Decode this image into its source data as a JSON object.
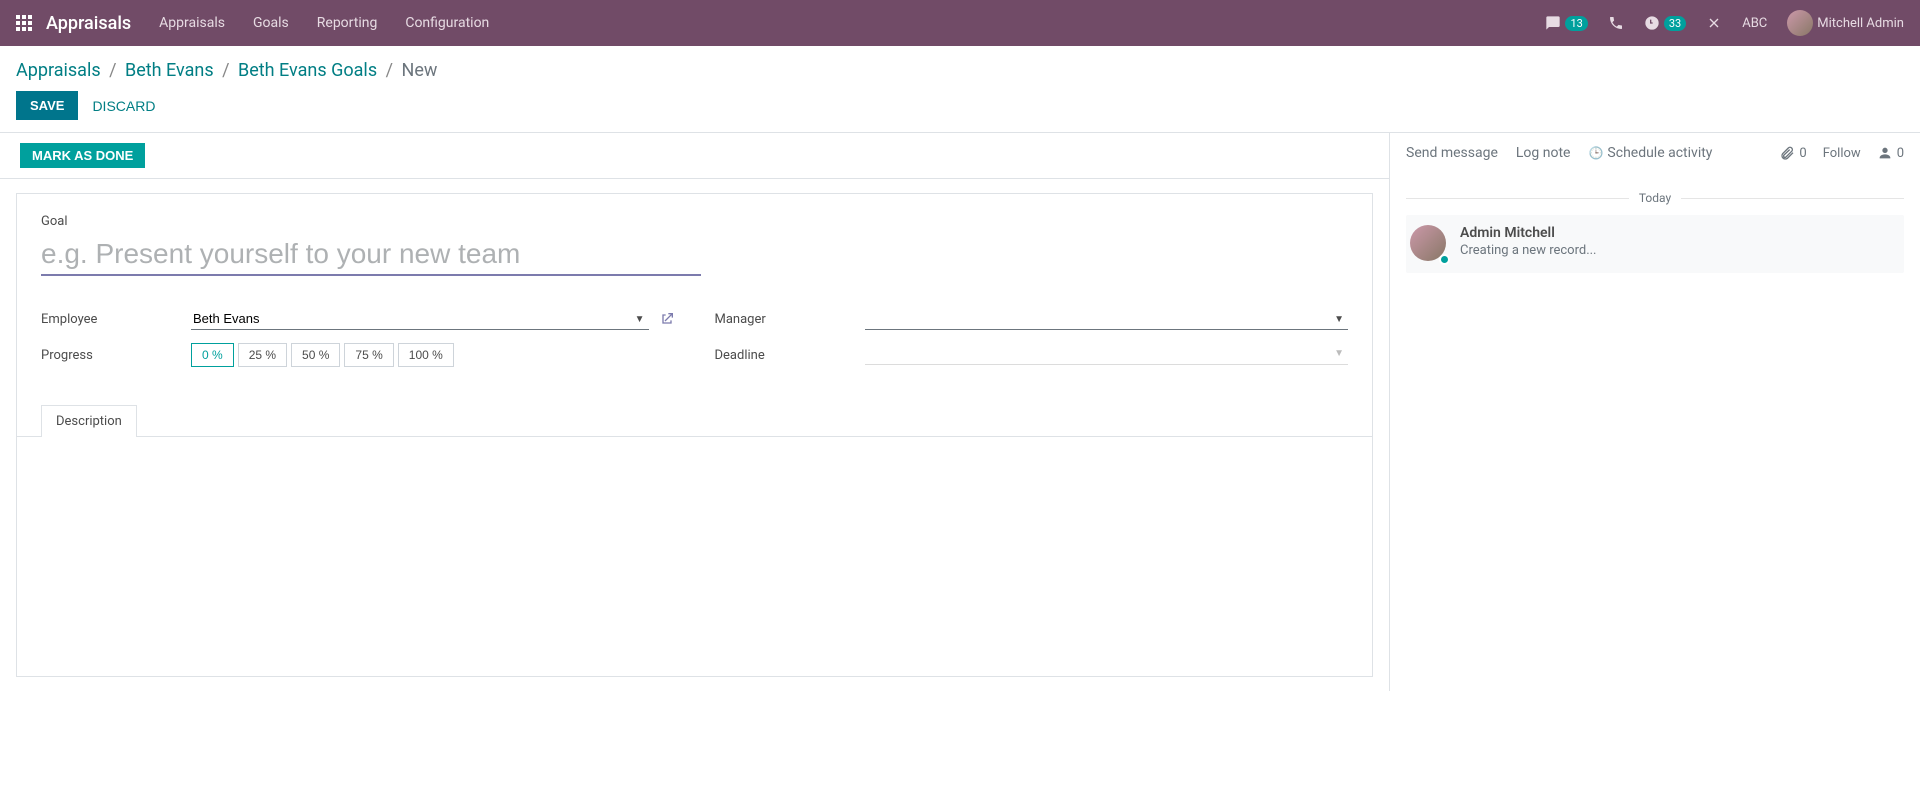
{
  "topbar": {
    "brand": "Appraisals",
    "nav": [
      "Appraisals",
      "Goals",
      "Reporting",
      "Configuration"
    ],
    "msg_count": "13",
    "activity_count": "33",
    "company": "ABC",
    "user": "Mitchell Admin"
  },
  "breadcrumbs": {
    "items": [
      "Appraisals",
      "Beth Evans",
      "Beth Evans Goals"
    ],
    "current": "New"
  },
  "buttons": {
    "save": "SAVE",
    "discard": "DISCARD",
    "mark_done": "MARK AS DONE"
  },
  "form": {
    "goal_label": "Goal",
    "goal_placeholder": "e.g. Present yourself to your new team",
    "employee_label": "Employee",
    "employee_value": "Beth Evans",
    "progress_label": "Progress",
    "progress_options": [
      "0 %",
      "25 %",
      "50 %",
      "75 %",
      "100 %"
    ],
    "progress_selected": "0 %",
    "manager_label": "Manager",
    "manager_value": "",
    "deadline_label": "Deadline",
    "deadline_value": "",
    "tab_description": "Description"
  },
  "chatter": {
    "send": "Send message",
    "log": "Log note",
    "schedule": "Schedule activity",
    "attach_count": "0",
    "follow": "Follow",
    "followers_count": "0",
    "today": "Today",
    "msg_author": "Admin Mitchell",
    "msg_text": "Creating a new record..."
  }
}
